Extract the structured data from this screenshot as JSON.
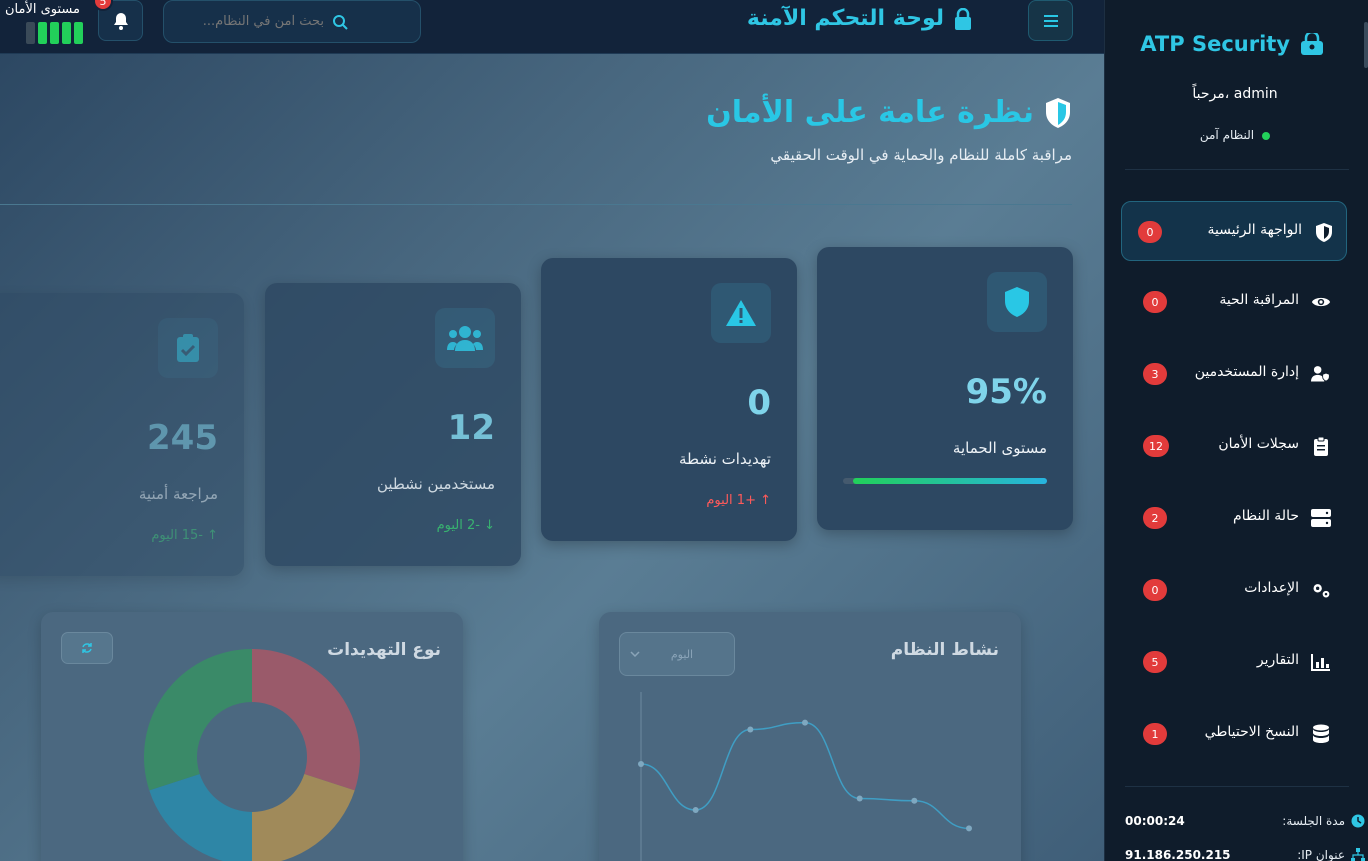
{
  "topbar": {
    "title": "لوحة التحكم الآمنة",
    "search_placeholder": "بحث آمن في النظام...",
    "notifications_count": "5",
    "security_level_label": "مستوى الأمان"
  },
  "header": {
    "title": "نظرة عامة على الأمان",
    "subtitle": "مراقبة كاملة للنظام والحماية في الوقت الحقيقي"
  },
  "cards": {
    "protection": {
      "value": "95%",
      "label": "مستوى الحماية",
      "progress": 95
    },
    "threats": {
      "value": "0",
      "label": "تهديدات نشطة",
      "trend": "+1 اليوم"
    },
    "users": {
      "value": "12",
      "label": "مستخدمين نشطين",
      "trend": "-2 اليوم"
    },
    "reviews": {
      "value": "245",
      "label": "مراجعة أمنية",
      "trend": "-15 اليوم"
    }
  },
  "panels": {
    "threat_types": {
      "title": "نوع التهديدات"
    },
    "system_activity": {
      "title": "نشاط النظام",
      "range": "اليوم"
    }
  },
  "chart_data": [
    {
      "type": "pie",
      "title": "نوع التهديدات",
      "values": [
        30,
        20,
        20,
        30
      ],
      "colors": [
        "#9a5a6a",
        "#a08a5a",
        "#2e86a6",
        "#3a8a68"
      ]
    },
    {
      "type": "line",
      "title": "نشاط النظام",
      "values": [
        60,
        40,
        75,
        78,
        45,
        44,
        32
      ]
    }
  ],
  "sidebar": {
    "brand": "ATP Security",
    "welcome": "مرحباً، admin",
    "status": "النظام آمن",
    "items": [
      {
        "label": "الواجهة الرئيسية",
        "badge": "0",
        "icon": "shield-icon"
      },
      {
        "label": "المراقبة الحية",
        "badge": "0",
        "icon": "eye-icon"
      },
      {
        "label": "إدارة المستخدمين",
        "badge": "3",
        "icon": "user-shield-icon"
      },
      {
        "label": "سجلات الأمان",
        "badge": "12",
        "icon": "clipboard-icon"
      },
      {
        "label": "حالة النظام",
        "badge": "2",
        "icon": "server-icon"
      },
      {
        "label": "الإعدادات",
        "badge": "0",
        "icon": "gears-icon"
      },
      {
        "label": "التقارير",
        "badge": "5",
        "icon": "chart-icon"
      },
      {
        "label": "النسخ الاحتياطي",
        "badge": "1",
        "icon": "database-icon"
      }
    ],
    "session_label": "مدة الجلسة:",
    "session_value": "00:00:24",
    "ip_label": "عنوان IP:",
    "ip_value": "91.186.250.215"
  },
  "colors": {
    "accent": "#2fc6e4",
    "danger": "#e23b3b",
    "success": "#22d05a"
  }
}
